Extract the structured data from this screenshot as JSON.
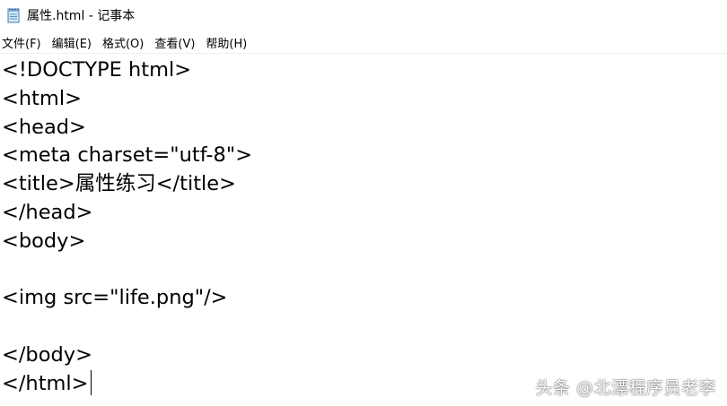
{
  "window": {
    "title": "属性.html - 记事本",
    "icon": "notepad-icon"
  },
  "menubar": {
    "items": [
      {
        "label": "文件(F)"
      },
      {
        "label": "编辑(E)"
      },
      {
        "label": "格式(O)"
      },
      {
        "label": "查看(V)"
      },
      {
        "label": "帮助(H)"
      }
    ]
  },
  "editor": {
    "lines": [
      "<!DOCTYPE html>",
      "<html>",
      "<head>",
      "<meta charset=\"utf-8\">",
      "<title>属性练习</title>",
      "</head>",
      "<body>",
      "",
      "<img src=\"life.png\"/>",
      "",
      "</body>",
      "</html>"
    ]
  },
  "watermark": {
    "text": "头条 @北漂程序员老李"
  }
}
